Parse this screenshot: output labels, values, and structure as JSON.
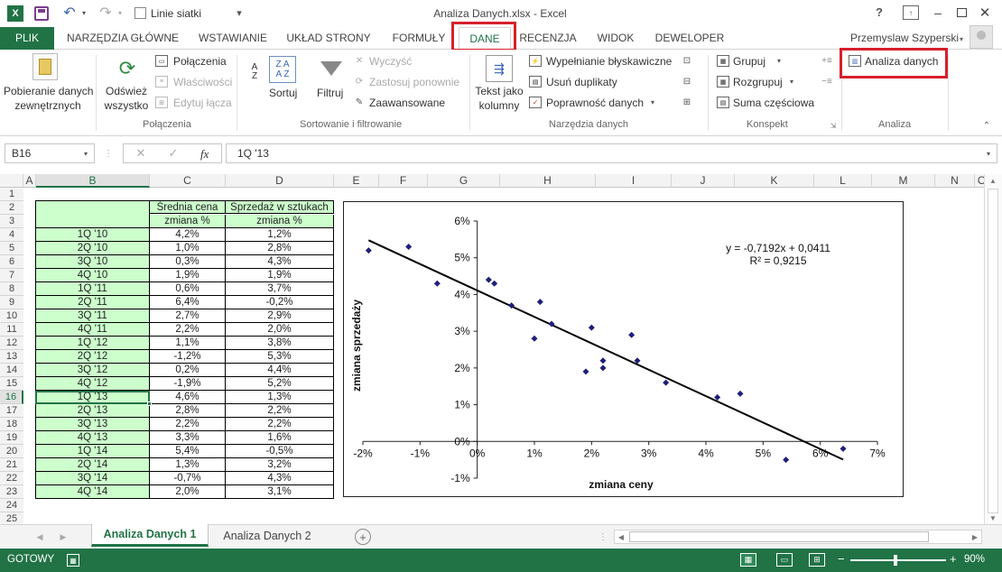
{
  "window": {
    "title": "Analiza Danych.xlsx - Excel",
    "gridlines_label": "Linie siatki",
    "help": "?",
    "user": "Przemyslaw Szyperski"
  },
  "tabs": [
    "PLIK",
    "NARZĘDZIA GŁÓWNE",
    "WSTAWIANIE",
    "UKŁAD STRONY",
    "FORMUŁY",
    "DANE",
    "RECENZJA",
    "WIDOK",
    "DEWELOPER"
  ],
  "ribbon": {
    "external": [
      "Pobieranie danych",
      "zewnętrznych"
    ],
    "refresh": [
      "Odśwież",
      "wszystko"
    ],
    "connections": "Połączenia",
    "properties": "Właściwości",
    "edit_links": "Edytuj łącza",
    "group_connections": "Połączenia",
    "sort": "Sortuj",
    "filter": "Filtruj",
    "clear": "Wyczyść",
    "reapply": "Zastosuj ponownie",
    "advanced": "Zaawansowane",
    "group_sort": "Sortowanie i filtrowanie",
    "text_to_columns": [
      "Tekst jako",
      "kolumny"
    ],
    "flash_fill": "Wypełnianie błyskawiczne",
    "remove_duplicates": "Usuń duplikaty",
    "validation": "Poprawność danych",
    "group_tools": "Narzędzia danych",
    "group": "Grupuj",
    "ungroup": "Rozgrupuj",
    "subtotal": "Suma częściowa",
    "group_outline": "Konspekt",
    "data_analysis": "Analiza danych",
    "group_analysis": "Analiza"
  },
  "formula_bar": {
    "name_box": "B16",
    "fx": "fx",
    "value": "1Q '13"
  },
  "columns": [
    "A",
    "B",
    "C",
    "D",
    "E",
    "F",
    "G",
    "H",
    "I",
    "J",
    "K",
    "L",
    "M",
    "N",
    "O"
  ],
  "rows": [
    "1",
    "2",
    "3",
    "4",
    "5",
    "6",
    "7",
    "8",
    "9",
    "10",
    "11",
    "12",
    "13",
    "14",
    "15",
    "16",
    "17",
    "18",
    "19",
    "20",
    "21",
    "22",
    "23",
    "24",
    "25"
  ],
  "table": {
    "header_c": [
      "Średnia cena",
      "zmiana %"
    ],
    "header_d": [
      "Sprzedaż w sztukach",
      "zmiana %"
    ],
    "rows": [
      [
        "1Q '10",
        "4,2%",
        "1,2%"
      ],
      [
        "2Q '10",
        "1,0%",
        "2,8%"
      ],
      [
        "3Q '10",
        "0,3%",
        "4,3%"
      ],
      [
        "4Q '10",
        "1,9%",
        "1,9%"
      ],
      [
        "1Q '11",
        "0,6%",
        "3,7%"
      ],
      [
        "2Q '11",
        "6,4%",
        "-0,2%"
      ],
      [
        "3Q '11",
        "2,7%",
        "2,9%"
      ],
      [
        "4Q '11",
        "2,2%",
        "2,0%"
      ],
      [
        "1Q '12",
        "1,1%",
        "3,8%"
      ],
      [
        "2Q '12",
        "-1,2%",
        "5,3%"
      ],
      [
        "3Q '12",
        "0,2%",
        "4,4%"
      ],
      [
        "4Q '12",
        "-1,9%",
        "5,2%"
      ],
      [
        "1Q '13",
        "4,6%",
        "1,3%"
      ],
      [
        "2Q '13",
        "2,8%",
        "2,2%"
      ],
      [
        "3Q '13",
        "2,2%",
        "2,2%"
      ],
      [
        "4Q '13",
        "3,3%",
        "1,6%"
      ],
      [
        "1Q '14",
        "5,4%",
        "-0,5%"
      ],
      [
        "2Q '14",
        "1,3%",
        "3,2%"
      ],
      [
        "3Q '14",
        "-0,7%",
        "4,3%"
      ],
      [
        "4Q '14",
        "2,0%",
        "3,1%"
      ]
    ]
  },
  "chart_data": {
    "type": "scatter",
    "xlabel": "zmiana ceny",
    "ylabel": "zmiana sprzedaży",
    "xlim": [
      -0.02,
      0.07
    ],
    "ylim": [
      -0.01,
      0.06
    ],
    "xticks": [
      "-2%",
      "-1%",
      "0%",
      "1%",
      "2%",
      "3%",
      "4%",
      "5%",
      "6%",
      "7%"
    ],
    "yticks": [
      "-1%",
      "0%",
      "1%",
      "2%",
      "3%",
      "4%",
      "5%",
      "6%"
    ],
    "points": [
      [
        0.042,
        0.012
      ],
      [
        0.01,
        0.028
      ],
      [
        0.003,
        0.043
      ],
      [
        0.019,
        0.019
      ],
      [
        0.006,
        0.037
      ],
      [
        0.064,
        -0.002
      ],
      [
        0.027,
        0.029
      ],
      [
        0.022,
        0.02
      ],
      [
        0.011,
        0.038
      ],
      [
        -0.012,
        0.053
      ],
      [
        0.002,
        0.044
      ],
      [
        -0.019,
        0.052
      ],
      [
        0.046,
        0.013
      ],
      [
        0.028,
        0.022
      ],
      [
        0.022,
        0.022
      ],
      [
        0.033,
        0.016
      ],
      [
        0.054,
        -0.005
      ],
      [
        0.013,
        0.032
      ],
      [
        -0.007,
        0.043
      ],
      [
        0.02,
        0.031
      ]
    ],
    "trendline": {
      "slope": -0.7192,
      "intercept": 0.0411,
      "x_range": [
        -0.019,
        0.064
      ]
    },
    "equation": "y = -0,7192x + 0,0411",
    "r2": "R² = 0,9215",
    "grid": false,
    "marker_color": "#1f1f7a"
  },
  "sheets": [
    "Analiza Danych 1",
    "Analiza Danych 2"
  ],
  "status": {
    "ready": "GOTOWY",
    "zoom": "90%"
  },
  "colors": {
    "accent": "#217346",
    "highlight": "#d6202b",
    "table_fill": "#ccffcc"
  }
}
